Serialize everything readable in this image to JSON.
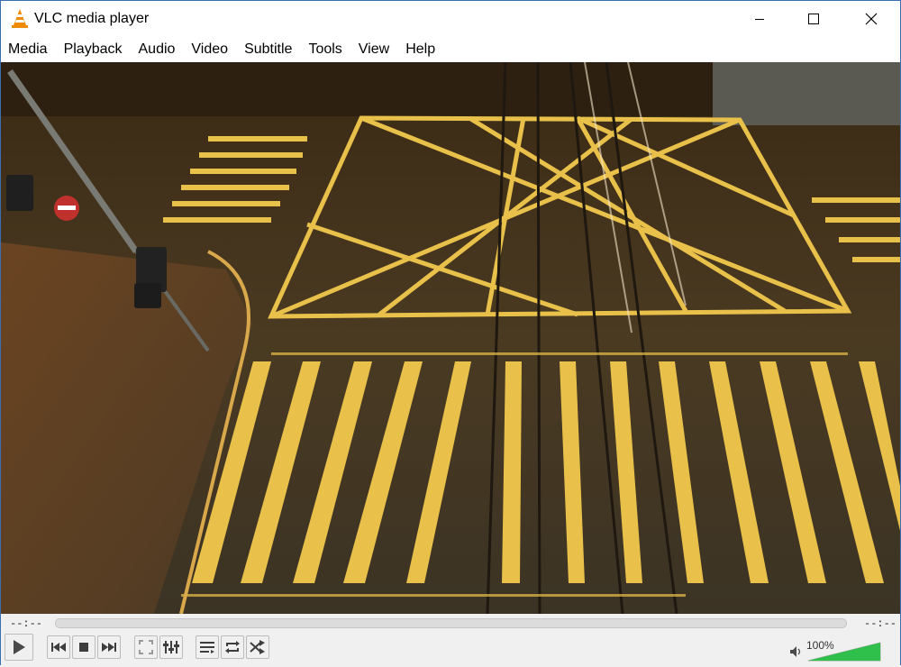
{
  "window": {
    "title": "VLC media player",
    "app_icon": "vlc-cone-icon"
  },
  "title_buttons": {
    "minimize_icon": "minimize-icon",
    "maximize_icon": "maximize-icon",
    "close_icon": "close-icon"
  },
  "menu": [
    {
      "label": "Media"
    },
    {
      "label": "Playback"
    },
    {
      "label": "Audio"
    },
    {
      "label": "Video"
    },
    {
      "label": "Subtitle"
    },
    {
      "label": "Tools"
    },
    {
      "label": "View"
    },
    {
      "label": "Help"
    }
  ],
  "player": {
    "elapsed": "--:--",
    "remaining": "--:--",
    "volume_label": "100%",
    "volume_level": 1.0
  },
  "controls": [
    {
      "icon": "play-icon"
    },
    {
      "icon": "previous-icon"
    },
    {
      "icon": "stop-icon"
    },
    {
      "icon": "next-icon"
    },
    {
      "icon": "fullscreen-icon"
    },
    {
      "icon": "extended-settings-icon"
    },
    {
      "icon": "playlist-icon"
    },
    {
      "icon": "loop-icon"
    },
    {
      "icon": "shuffle-icon"
    },
    {
      "icon": "speaker-icon"
    }
  ],
  "colors": {
    "accent": "#3c6fb0",
    "volume_green": "#2ec04a",
    "road_marking": "#e9c14a"
  }
}
